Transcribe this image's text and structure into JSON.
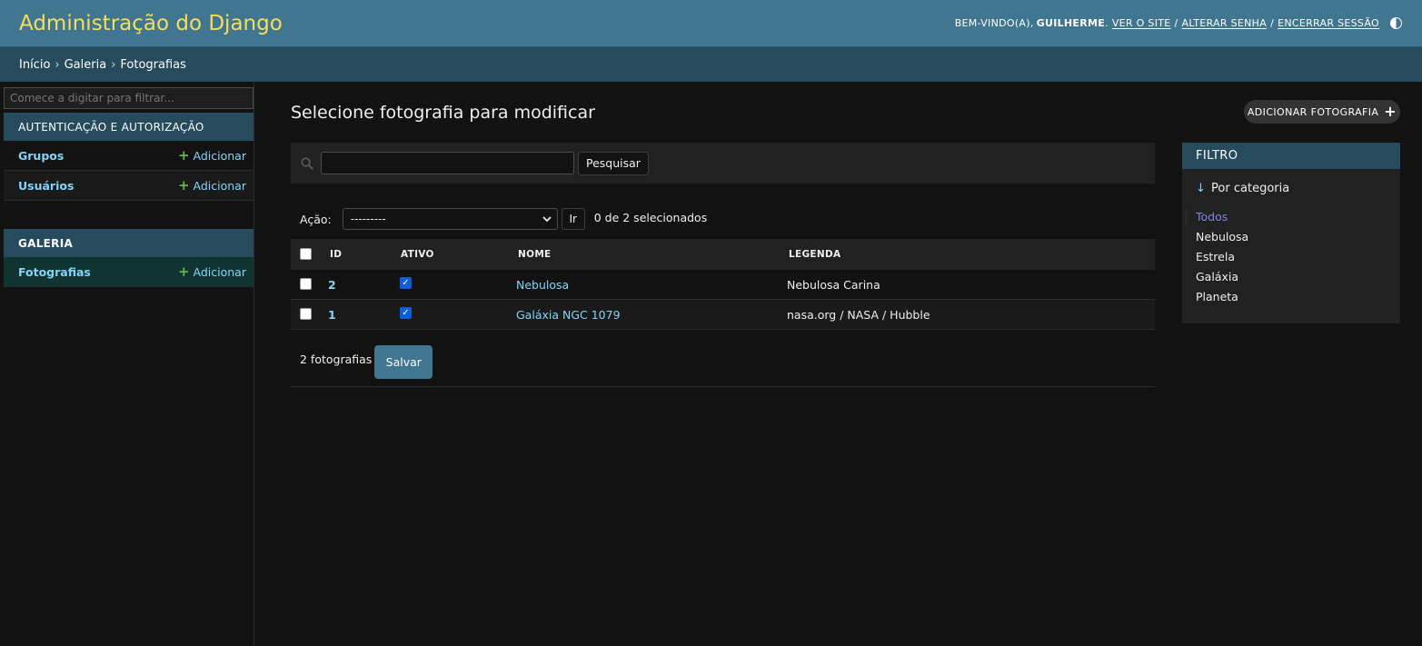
{
  "header": {
    "site_name": "Administração do Django",
    "welcome": "BEM-VINDO(A),",
    "username": "GUILHERME",
    "view_site": "VER O SITE",
    "change_password": "ALTERAR SENHA",
    "logout": "ENCERRAR SESSÃO",
    "separator": "/"
  },
  "breadcrumbs": [
    "Início",
    "Galeria",
    "Fotografias"
  ],
  "breadcrumb_separator": "›",
  "sidebar": {
    "filter_placeholder": "Comece a digitar para filtrar...",
    "apps": [
      {
        "caption": "AUTENTICAÇÃO E AUTORIZAÇÃO",
        "models": [
          {
            "name": "Grupos",
            "add_label": "Adicionar"
          },
          {
            "name": "Usuários",
            "add_label": "Adicionar"
          }
        ]
      },
      {
        "caption": "GALERIA",
        "models": [
          {
            "name": "Fotografias",
            "add_label": "Adicionar",
            "current": true
          }
        ]
      }
    ]
  },
  "content": {
    "title": "Selecione fotografia para modificar",
    "add_button": "ADICIONAR FOTOGRAFIA",
    "search_button": "Pesquisar",
    "search_value": "",
    "action_label": "Ação:",
    "action_selected": "---------",
    "go_button": "Ir",
    "selection_counter": "0 de 2 selecionados",
    "table": {
      "headers": [
        "ID",
        "ATIVO",
        "NOME",
        "LEGENDA"
      ],
      "rows": [
        {
          "id": "2",
          "ativo": true,
          "nome": "Nebulosa",
          "legenda": "Nebulosa Carina"
        },
        {
          "id": "1",
          "ativo": true,
          "nome": "Galáxia NGC 1079",
          "legenda": "nasa.org / NASA / Hubble"
        }
      ]
    },
    "result_count": "2 fotografias",
    "save_button": "Salvar"
  },
  "filter": {
    "title": "FILTRO",
    "subtitle_arrow": "↓",
    "subtitle": "Por categoria",
    "options": [
      "Todos",
      "Nebulosa",
      "Estrela",
      "Galáxia",
      "Planeta"
    ],
    "selected": "Todos"
  },
  "colors": {
    "header_bg": "#417690",
    "site_name": "#f5dd5d",
    "breadcrumbs_bg": "#264b5d",
    "link": "#81d4fa",
    "add_plus": "#5fb74b",
    "page_bg": "#121212"
  },
  "icons": {
    "search": "search-icon",
    "theme": "theme-toggle-icon",
    "add": "plus-icon",
    "select": "chevron-down-icon"
  }
}
